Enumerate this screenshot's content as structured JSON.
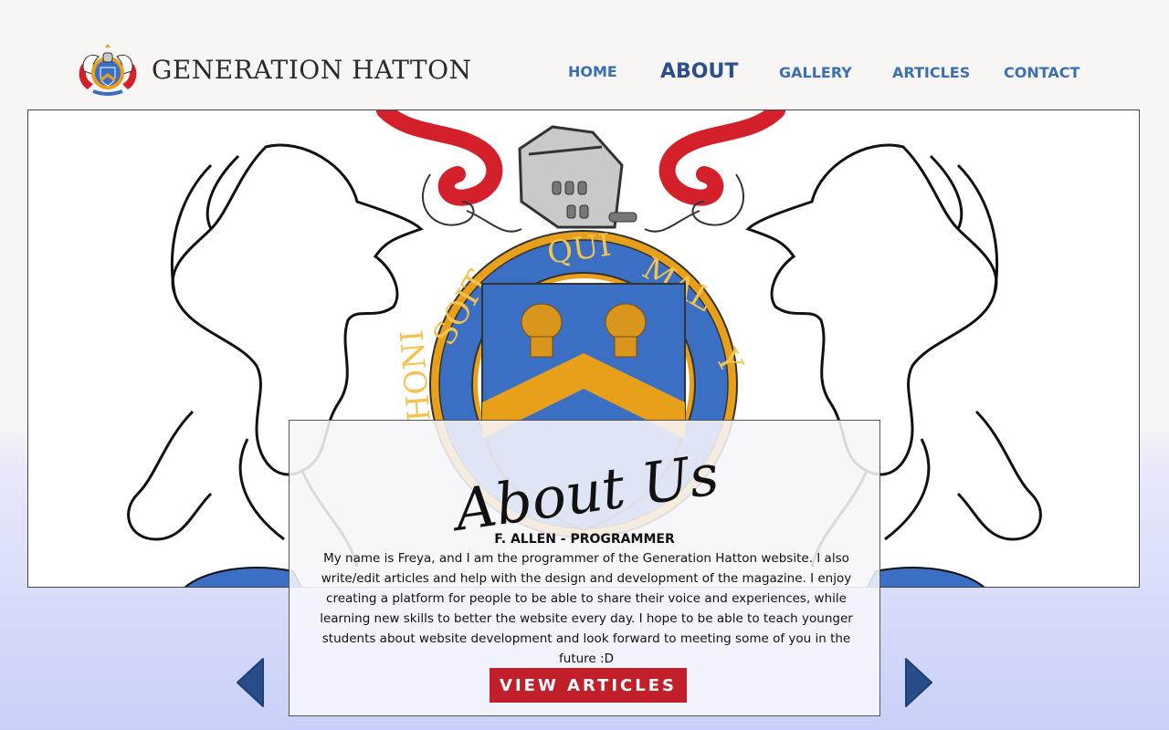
{
  "header": {
    "site_title": "GENERATION HATTON",
    "logo_icon": "crest-icon"
  },
  "nav": {
    "home": "HOME",
    "about": "ABOUT",
    "gallery": "GALLERY",
    "articles": "ARTICLES",
    "contact": "CONTACT"
  },
  "hero": {
    "image": "coat-of-arms-illustration",
    "motto": "HONI SOIT QUI MAL Y PENSE"
  },
  "card": {
    "heading": "About Us",
    "subtitle": "F. ALLEN - PROGRAMMER",
    "body": "My name is Freya, and I am the programmer of the Generation Hatton website. I also write/edit articles and help with the design and development of the magazine. I enjoy creating a platform for people to be able to share their voice and experiences, while learning new skills to better the website every day. I hope to be able to teach younger students about website development and look forward to meeting some of you in the future :D",
    "cta_label": "VIEW ARTICLES"
  },
  "controls": {
    "prev_icon": "chevron-left-icon",
    "next_icon": "chevron-right-icon"
  },
  "colors": {
    "nav_link": "#3a6fb4",
    "nav_active": "#2a4f8c",
    "cta_background": "#c11f2a",
    "arrow": "#274d8a",
    "shield_blue": "#3a6fc4",
    "garter_gold": "#e8a01a",
    "mantling_red": "#d3202a"
  }
}
